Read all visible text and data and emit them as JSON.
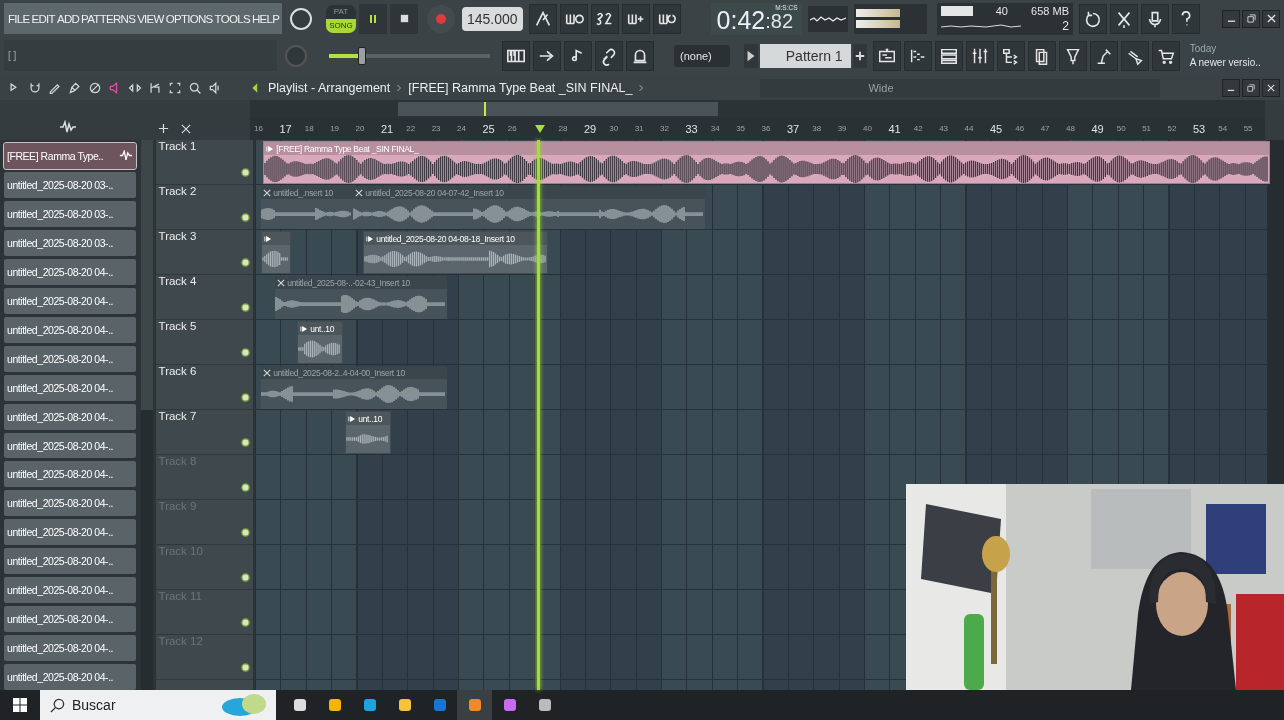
{
  "menu": [
    "FILE",
    "EDIT",
    "ADD",
    "PATTERNS",
    "VIEW",
    "OPTIONS",
    "TOOLS",
    "HELP"
  ],
  "hint": "[ ]",
  "transport_modes": [
    {
      "label": "PAT",
      "selected": false
    },
    {
      "label": "SONG",
      "selected": true
    }
  ],
  "tempo": "145.000",
  "time": {
    "main": "0:42",
    "centis": ":82",
    "unit": "M:S:CS"
  },
  "monitor": {
    "cpu": "40",
    "memory": "658 MB",
    "polyphony": "2"
  },
  "master_volume": {
    "level": 0.2
  },
  "pattern_selector": {
    "channel": "(none)",
    "pattern": "Pattern 1"
  },
  "news": {
    "date": "Today",
    "text": "A newer versio.."
  },
  "playlist": {
    "title": "Playlist - Arrangement",
    "song": "[FREE] Ramma Type Beat _SIN FINAL_",
    "snap": "Wide",
    "ruler": [
      {
        "label": "16",
        "major": false
      },
      {
        "label": "17",
        "major": true
      },
      {
        "label": "18",
        "major": false
      },
      {
        "label": "19",
        "major": false
      },
      {
        "label": "20",
        "major": false
      },
      {
        "label": "21",
        "major": true
      },
      {
        "label": "22",
        "major": false
      },
      {
        "label": "23",
        "major": false
      },
      {
        "label": "24",
        "major": false
      },
      {
        "label": "25",
        "major": true
      },
      {
        "label": "26",
        "major": false
      },
      {
        "kind": "playhead"
      },
      {
        "label": "28",
        "major": false
      },
      {
        "label": "29",
        "major": true
      },
      {
        "label": "30",
        "major": false
      },
      {
        "label": "31",
        "major": false
      },
      {
        "label": "32",
        "major": false
      },
      {
        "label": "33",
        "major": true
      },
      {
        "label": "34",
        "major": false
      },
      {
        "label": "35",
        "major": false
      },
      {
        "label": "36",
        "major": false
      },
      {
        "label": "37",
        "major": true
      },
      {
        "label": "38",
        "major": false
      },
      {
        "label": "39",
        "major": false
      },
      {
        "label": "40",
        "major": false
      },
      {
        "label": "41",
        "major": true
      },
      {
        "label": "42",
        "major": false
      },
      {
        "label": "43",
        "major": false
      },
      {
        "label": "44",
        "major": false
      },
      {
        "label": "45",
        "major": true
      },
      {
        "label": "46",
        "major": false
      },
      {
        "label": "47",
        "major": false
      },
      {
        "label": "48",
        "major": false
      },
      {
        "label": "49",
        "major": true
      },
      {
        "label": "50",
        "major": false
      },
      {
        "label": "51",
        "major": false
      },
      {
        "label": "52",
        "major": false
      },
      {
        "label": "53",
        "major": true
      },
      {
        "label": "54",
        "major": false
      },
      {
        "label": "55",
        "major": false
      }
    ],
    "clip_list": [
      {
        "label": "[FREE] Ramma Type..",
        "selected": true
      },
      {
        "label": "untitled_2025-08-20 03-..",
        "selected": false
      },
      {
        "label": "untitled_2025-08-20 03-..",
        "selected": false
      },
      {
        "label": "untitled_2025-08-20 03-..",
        "selected": false
      },
      {
        "label": "untitled_2025-08-20 04-..",
        "selected": false
      },
      {
        "label": "untitled_2025-08-20 04-..",
        "selected": false
      },
      {
        "label": "untitled_2025-08-20 04-..",
        "selected": false
      },
      {
        "label": "untitled_2025-08-20 04-..",
        "selected": false
      },
      {
        "label": "untitled_2025-08-20 04-..",
        "selected": false
      },
      {
        "label": "untitled_2025-08-20 04-..",
        "selected": false
      },
      {
        "label": "untitled_2025-08-20 04-..",
        "selected": false
      },
      {
        "label": "untitled_2025-08-20 04-..",
        "selected": false
      },
      {
        "label": "untitled_2025-08-20 04-..",
        "selected": false
      },
      {
        "label": "untitled_2025-08-20 04-..",
        "selected": false
      },
      {
        "label": "untitled_2025-08-20 04-..",
        "selected": false
      },
      {
        "label": "untitled_2025-08-20 04-..",
        "selected": false
      },
      {
        "label": "untitled_2025-08-20 04-..",
        "selected": false
      },
      {
        "label": "untitled_2025-08-20 04-..",
        "selected": false
      },
      {
        "label": "untitled_2025-08-20 04-..",
        "selected": false
      }
    ],
    "tracks": [
      {
        "name": "Track 1",
        "active": true
      },
      {
        "name": "Track 2",
        "active": true
      },
      {
        "name": "Track 3",
        "active": true
      },
      {
        "name": "Track 4",
        "active": true
      },
      {
        "name": "Track 5",
        "active": true
      },
      {
        "name": "Track 6",
        "active": true
      },
      {
        "name": "Track 7",
        "active": true
      },
      {
        "name": "Track 8",
        "active": false
      },
      {
        "name": "Track 9",
        "active": false
      },
      {
        "name": "Track 10",
        "active": false
      },
      {
        "name": "Track 11",
        "active": false
      },
      {
        "name": "Track 12",
        "active": false
      }
    ],
    "clips": [
      {
        "title": "[FREE] Ramma Type Beat _SIN FINAL_",
        "muted": false,
        "color": "#d9a9bb"
      },
      {
        "title": "untitled_.nsert 10",
        "muted": true,
        "color": "#46535a"
      },
      {
        "title": "untitled_2025-08-20 04-07-42_Insert 10",
        "muted": true,
        "color": "#46535a"
      },
      {
        "muted": false,
        "color": "#5b666c"
      },
      {
        "title": "untitled_2025-08-20 04-08-18_Insert 10",
        "muted": false,
        "color": "#5b666c"
      },
      {
        "title": "untitled_2025-08-..-02-43_Insert 10",
        "muted": true,
        "color": "#46535a"
      },
      {
        "title": "unt..10",
        "muted": false,
        "color": "#5b666c"
      },
      {
        "title": "untitled_2025-08-2..4-04-00_Insert 10",
        "muted": true,
        "color": "#46535a"
      },
      {
        "title": "unt..10",
        "muted": false,
        "color": "#5b666c"
      }
    ]
  },
  "taskbar": {
    "search_placeholder": "Buscar"
  }
}
